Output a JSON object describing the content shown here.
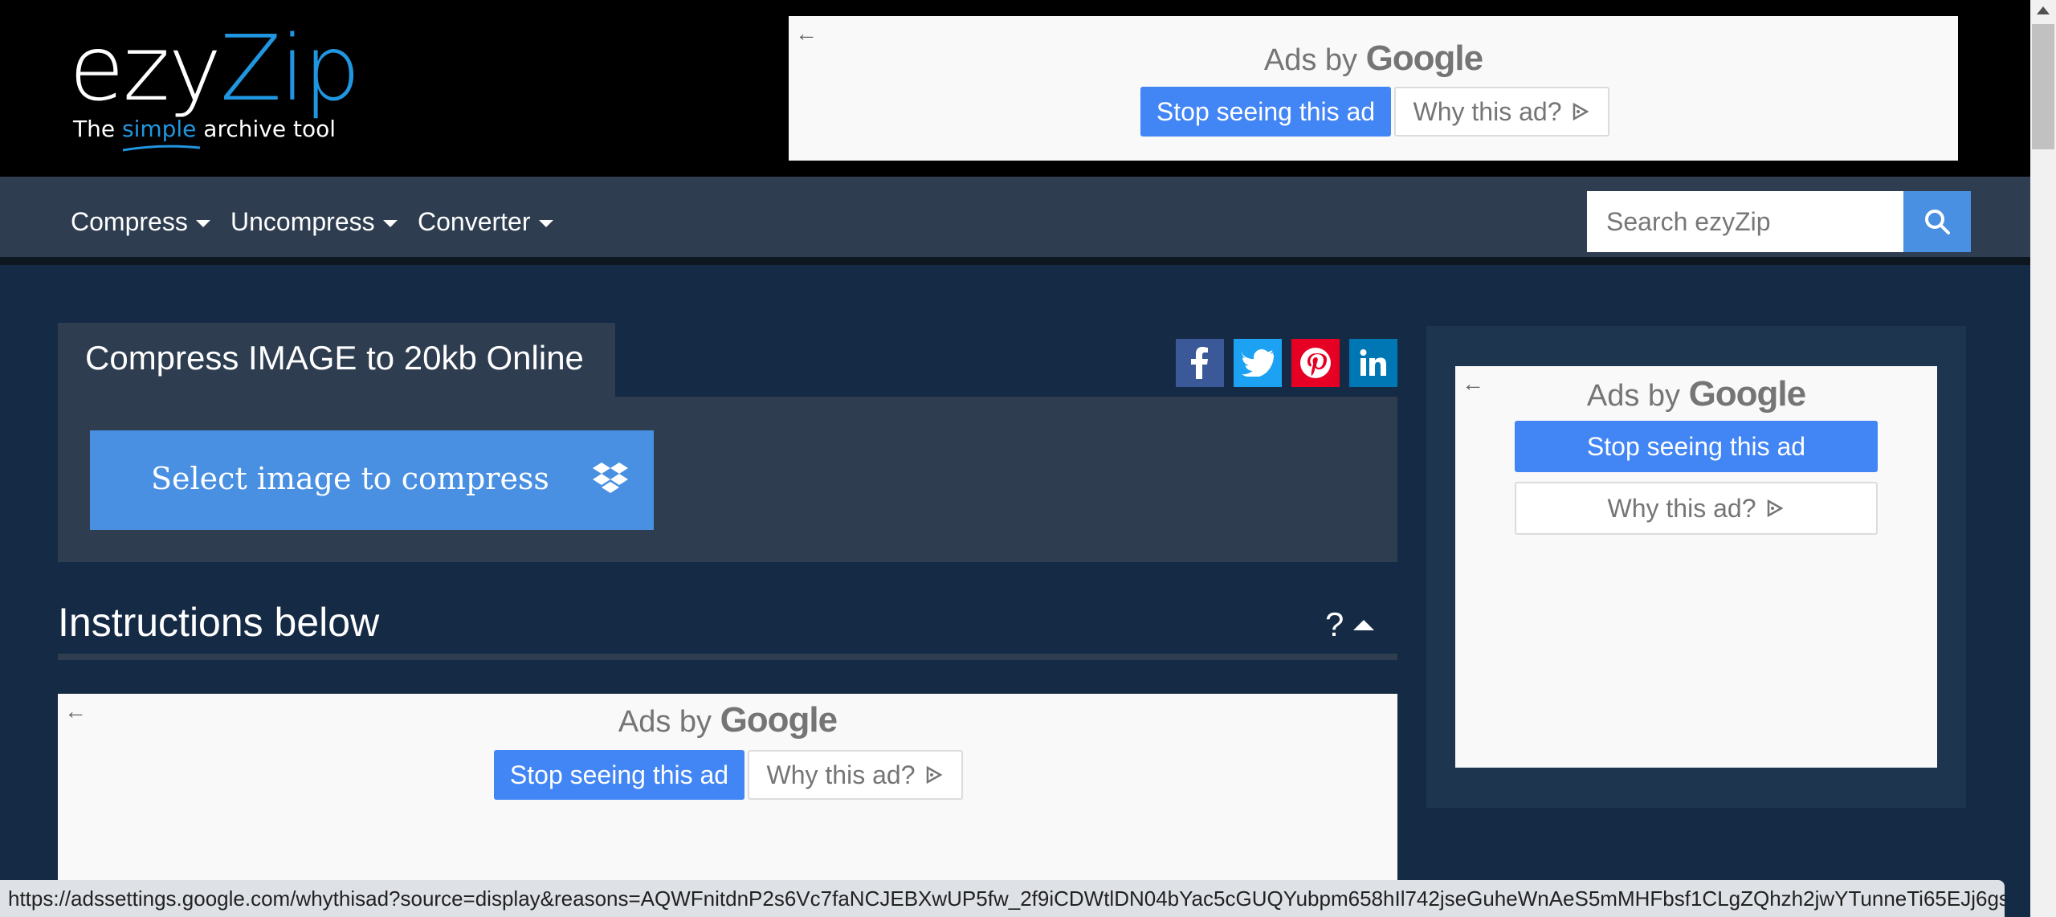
{
  "logo": {
    "ezy": "ezy",
    "zip": "Zip",
    "tag_pre": "The ",
    "tag_simple": "simple",
    "tag_post": " archive tool"
  },
  "ads": {
    "ads_by": "Ads by",
    "google": "Google",
    "stop": "Stop seeing this ad",
    "why": "Why this ad?",
    "back": "←"
  },
  "nav": {
    "items": [
      {
        "label": "Compress"
      },
      {
        "label": "Uncompress"
      },
      {
        "label": "Converter"
      }
    ],
    "search_placeholder": "Search ezyZip"
  },
  "main": {
    "title": "Compress IMAGE to 20kb Online",
    "select_label": "Select image to compress",
    "instructions": "Instructions below",
    "help": "?"
  },
  "social": [
    {
      "name": "facebook",
      "glyph": "f",
      "color": "#3b5998"
    },
    {
      "name": "twitter",
      "glyph": "t",
      "color": "#1da1f2"
    },
    {
      "name": "pinterest",
      "glyph": "p",
      "color": "#e60023"
    },
    {
      "name": "linkedin",
      "glyph": "in",
      "color": "#0077b5"
    }
  ],
  "colors": {
    "accent": "#4a90e2",
    "zip_blue": "#2196e0",
    "ad_button": "#4285f4"
  },
  "status_url": "https://adssettings.google.com/whythisad?source=display&reasons=AQWFnitdnP2s6Vc7faNCJEBXwUP5fw_2f9iCDWtlDN04bYac5cGUQYubpm658hIl742jseGuheWnAeS5mMHFbsf1CLgZQhzh2jwYTunneTi65EJj6gs7..."
}
